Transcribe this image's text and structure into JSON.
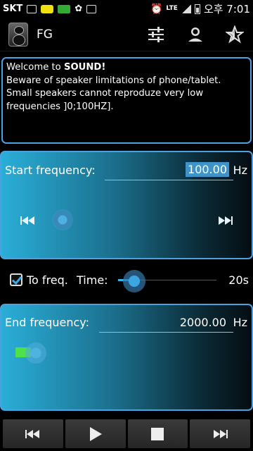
{
  "statusbar": {
    "carrier": "SKT",
    "network": "LTE",
    "time": "오후 7:01",
    "icons": [
      "image-icon",
      "kakao-icon",
      "message-icon",
      "pawprint-icon",
      "grid-icon",
      "alarm-icon",
      "signal-icon",
      "battery-icon"
    ]
  },
  "actionbar": {
    "title": "FG",
    "app_icon": "speaker-icon",
    "actions": [
      "equalizer-icon",
      "profile-icon",
      "star-add-icon"
    ]
  },
  "welcome": {
    "prefix": "Welcome to ",
    "app_name": "SOUND!",
    "body": "Beware of speaker limitations of phone/tablet. Small speakers cannot reproduze very low frequencies ]0;100HZ]."
  },
  "start": {
    "label": "Start frequency:",
    "value": "100.00",
    "unit": "Hz",
    "slider_level": 0.0
  },
  "sweep": {
    "checkbox_label": "To freq.",
    "checked": true,
    "time_label": "Time:",
    "time_value": "20s",
    "time_level": 0.1
  },
  "end": {
    "label": "End frequency:",
    "value": "2000.00",
    "unit": "Hz",
    "slider_level": 0.05
  },
  "controls": [
    "rewind-icon",
    "play-icon",
    "stop-icon",
    "fast-forward-icon"
  ],
  "colors": {
    "accent": "#33b5e5",
    "panel_border": "#4aa3e0",
    "level_green": "#4fe04a"
  }
}
